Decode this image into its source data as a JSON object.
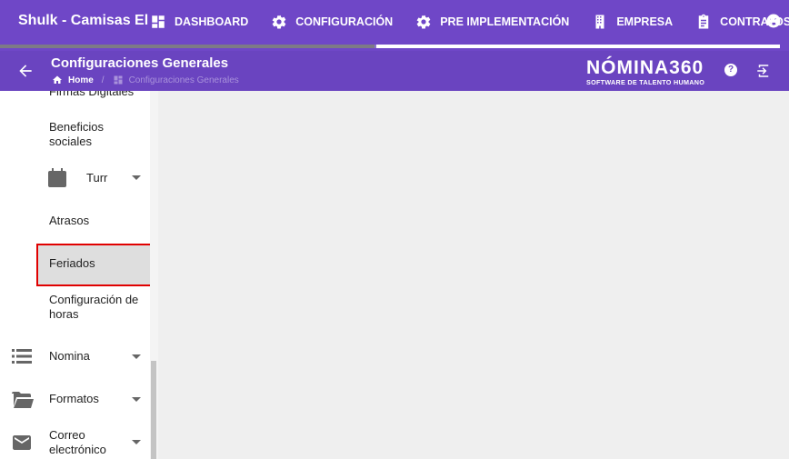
{
  "app": {
    "title": "Shulk - Camisas El"
  },
  "nav": [
    {
      "label": "DASHBOARD",
      "icon": "dashboard-icon"
    },
    {
      "label": "CONFIGURACIÓN",
      "icon": "gear-icon"
    },
    {
      "label": "PRE IMPLEMENTACIÓN",
      "icon": "gear-icon"
    },
    {
      "label": "EMPRESA",
      "icon": "building-icon"
    },
    {
      "label": "CONTRATOS",
      "icon": "clipboard-icon"
    }
  ],
  "progress": {
    "fraction": 0.48
  },
  "header": {
    "title": "Configuraciones Generales",
    "breadcrumb_home": "Home",
    "breadcrumb_sep": "/",
    "breadcrumb_current": "Configuraciones Generales"
  },
  "logo": {
    "main": "NÓMINA360",
    "sub": "SOFTWARE DE TALENTO HUMANO"
  },
  "help": {
    "glyph": "?"
  },
  "sidebar": {
    "cut_item": "Firmas Digitales",
    "items": [
      {
        "label": "Beneficios sociales"
      },
      {
        "label": "Turr",
        "icon": "calendar-icon"
      },
      {
        "label": "Atrasos"
      },
      {
        "label": "Feriados"
      },
      {
        "label": "Configuración de horas"
      },
      {
        "label": "Nomina",
        "icon": "list-icon"
      },
      {
        "label": "Formatos",
        "icon": "folder-icon"
      },
      {
        "label": "Correo electrónico",
        "icon": "mail-icon"
      }
    ]
  },
  "colors": {
    "topbar": "#6f47c7",
    "header": "#6a44c0",
    "highlight_border": "#e00000"
  }
}
